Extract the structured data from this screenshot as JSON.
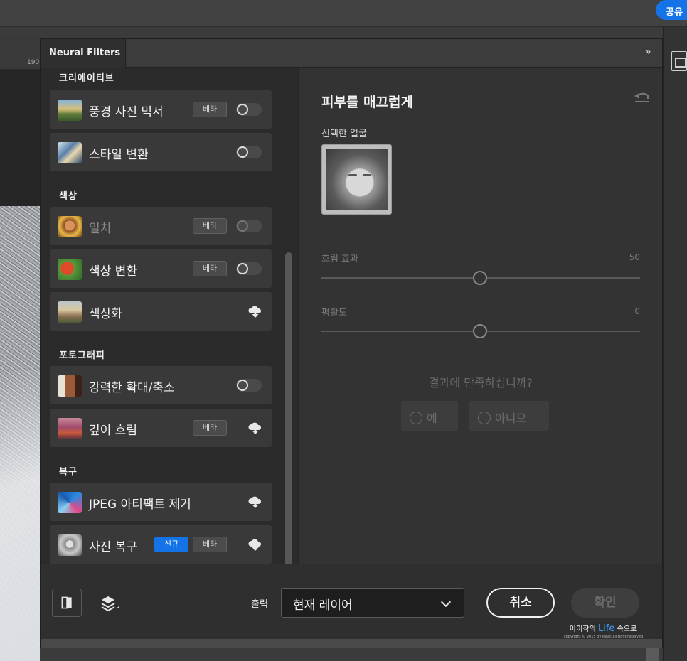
{
  "app": {
    "share_label": "공유",
    "ruler_value": "190"
  },
  "panel": {
    "title": "Neural Filters",
    "collapse_glyph": "»"
  },
  "categories": [
    {
      "label": "크리에이티브"
    },
    {
      "label": "색상"
    },
    {
      "label": "포토그래피"
    },
    {
      "label": "복구"
    }
  ],
  "filters": [
    {
      "name": "풍경 사진 믹서",
      "badge_beta": "베타",
      "control": "toggle"
    },
    {
      "name": "스타일 변환",
      "control": "toggle"
    },
    {
      "name": "일치",
      "badge_beta": "베타",
      "control": "toggle",
      "disabled": true
    },
    {
      "name": "색상 변환",
      "badge_beta": "베타",
      "control": "toggle"
    },
    {
      "name": "색상화",
      "control": "download"
    },
    {
      "name": "강력한 확대/축소",
      "control": "toggle"
    },
    {
      "name": "깊이 흐림",
      "badge_beta": "베타",
      "control": "download"
    },
    {
      "name": "JPEG 아티팩트 제거",
      "control": "download"
    },
    {
      "name": "사진 복구",
      "badge_new": "신규",
      "badge_beta": "베타",
      "control": "download"
    }
  ],
  "settings": {
    "title": "피부를 매끄럽게",
    "face_label": "선택한 얼굴",
    "sliders": [
      {
        "label": "흐림 효과",
        "value": "50"
      },
      {
        "label": "평활도",
        "value": "0"
      }
    ],
    "feedback_question": "결과에 만족하십니까?",
    "feedback_yes": "예",
    "feedback_no": "아니오"
  },
  "footer": {
    "output_label": "출력",
    "output_value": "현재 레이어",
    "cancel_label": "취소",
    "ok_label": "확인"
  },
  "watermark": {
    "text_prefix": "아이작의",
    "text_highlight": "Life",
    "text_suffix": "속으로",
    "copyright": "copyright © 2015 by isaac all right reserved"
  },
  "colors": {
    "accent": "#1473e6",
    "panel_bg": "#2f2f2f",
    "item_bg": "#393939"
  }
}
